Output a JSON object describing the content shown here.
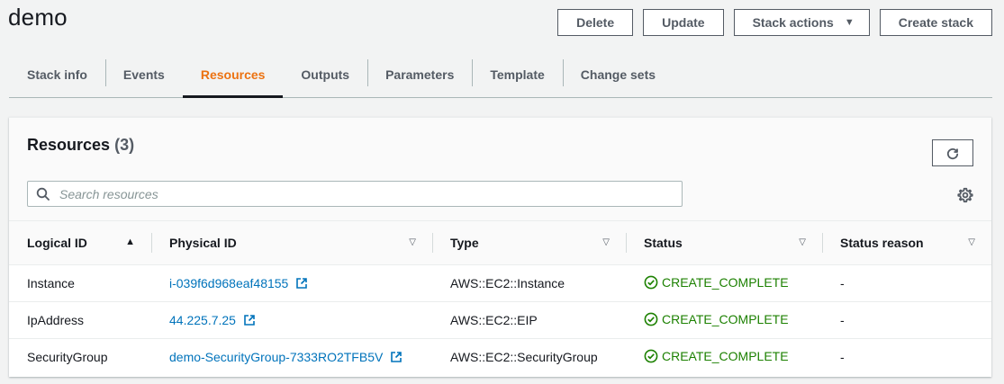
{
  "page": {
    "title": "demo"
  },
  "actions": {
    "delete": "Delete",
    "update": "Update",
    "stack_actions": "Stack actions",
    "create_stack": "Create stack"
  },
  "tabs": [
    {
      "label": "Stack info"
    },
    {
      "label": "Events"
    },
    {
      "label": "Resources",
      "active": true
    },
    {
      "label": "Outputs"
    },
    {
      "label": "Parameters"
    },
    {
      "label": "Template"
    },
    {
      "label": "Change sets"
    }
  ],
  "resources": {
    "title": "Resources",
    "count": "(3)",
    "search_placeholder": "Search resources",
    "icons": {
      "refresh": "refresh-icon",
      "settings": "gear-icon",
      "search": "search-icon"
    },
    "columns": [
      "Logical ID",
      "Physical ID",
      "Type",
      "Status",
      "Status reason"
    ],
    "rows": [
      {
        "logical_id": "Instance",
        "physical_id": "i-039f6d968eaf48155",
        "type": "AWS::EC2::Instance",
        "status": "CREATE_COMPLETE",
        "reason": "-"
      },
      {
        "logical_id": "IpAddress",
        "physical_id": "44.225.7.25",
        "type": "AWS::EC2::EIP",
        "status": "CREATE_COMPLETE",
        "reason": "-"
      },
      {
        "logical_id": "SecurityGroup",
        "physical_id": "demo-SecurityGroup-7333RO2TFB5V",
        "type": "AWS::EC2::SecurityGroup",
        "status": "CREATE_COMPLETE",
        "reason": "-"
      }
    ]
  },
  "colors": {
    "accent": "#ec7211",
    "link": "#0073bb",
    "success": "#1d8102"
  }
}
